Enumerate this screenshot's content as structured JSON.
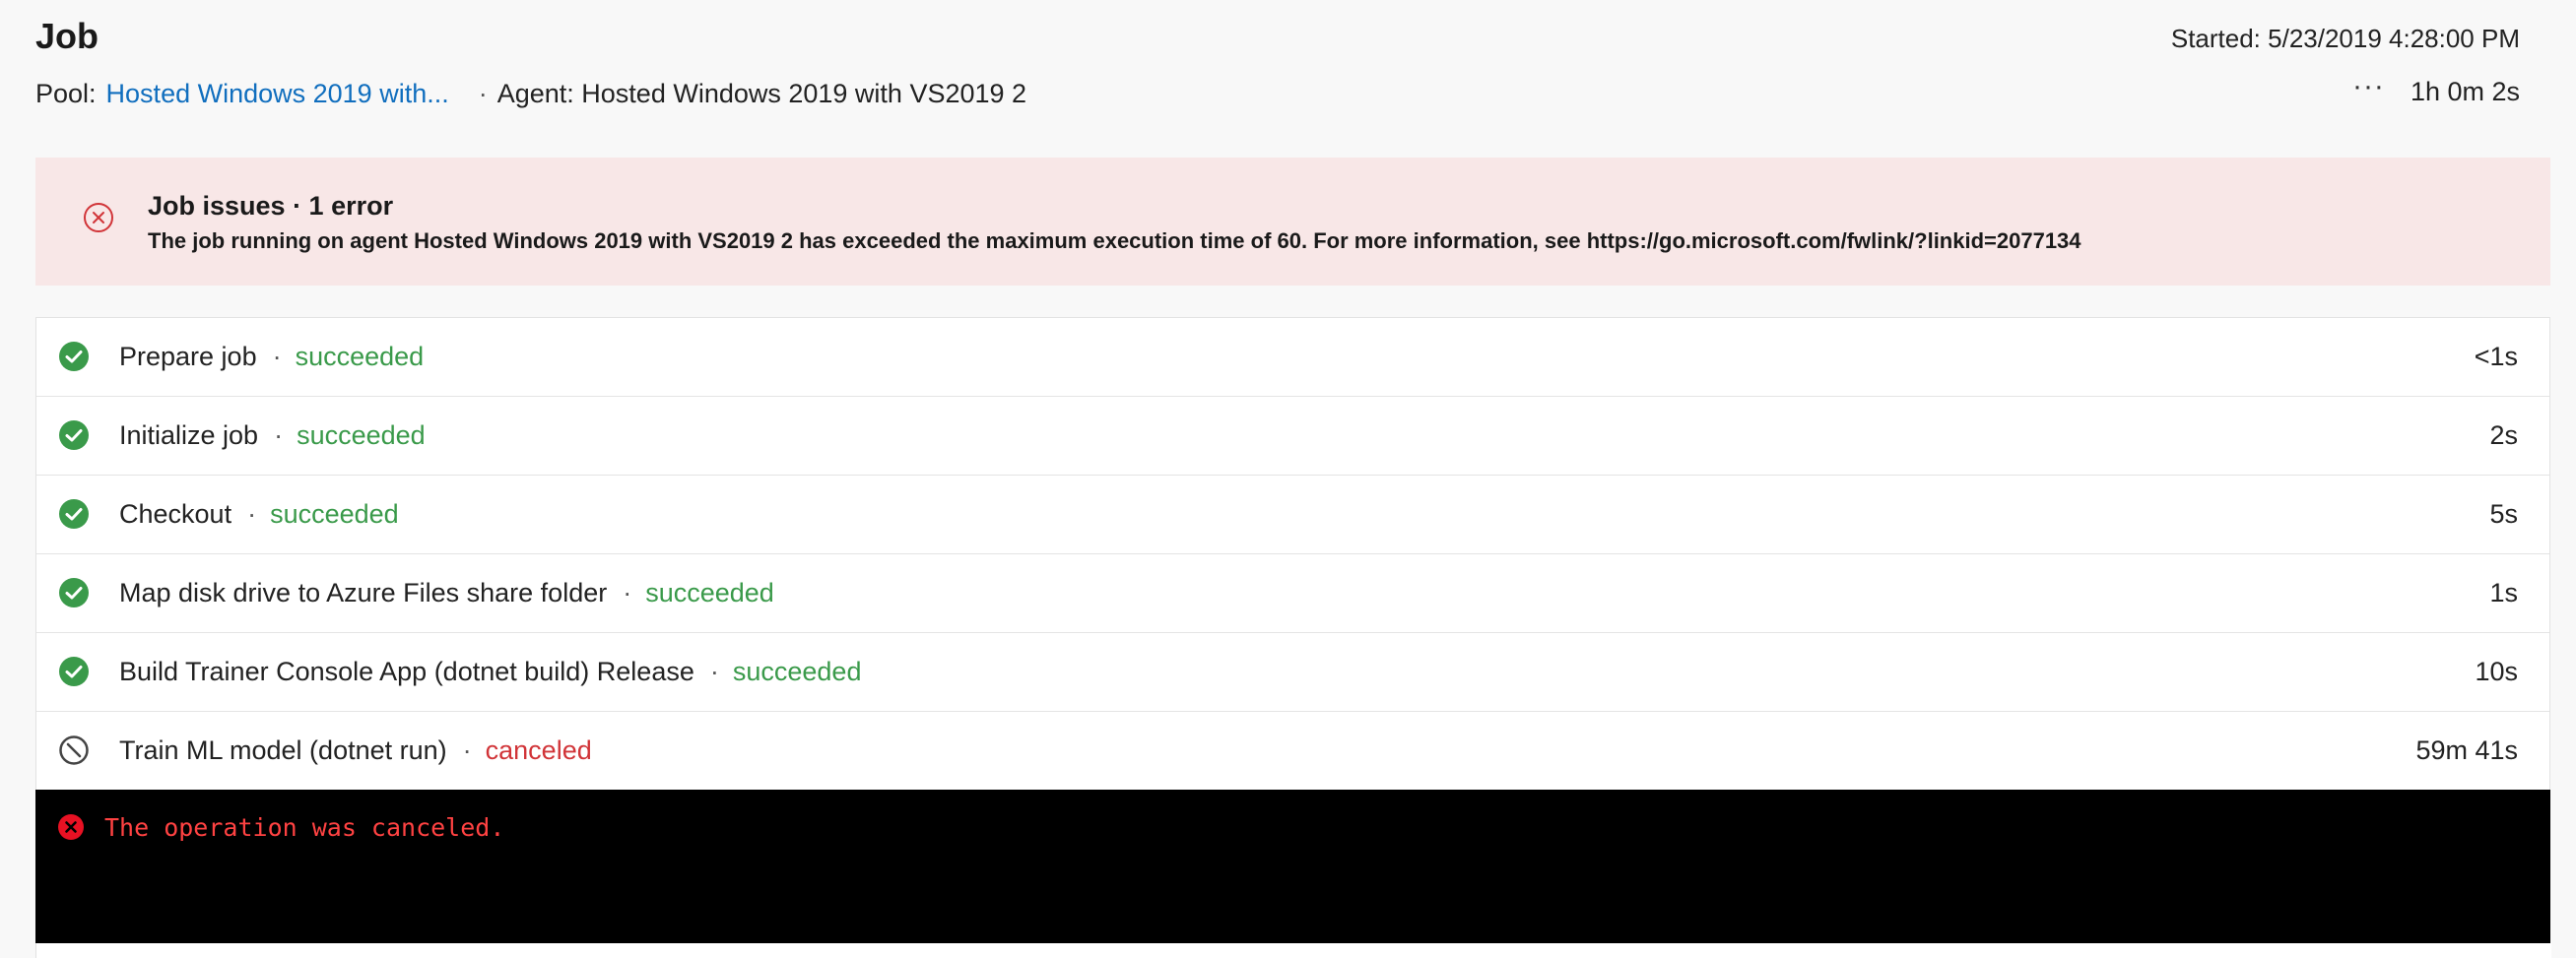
{
  "header": {
    "title": "Job",
    "started": "Started: 5/23/2019 4:28:00 PM",
    "pool_label": "Pool:",
    "pool_value": "Hosted Windows 2019 with...",
    "agent_sep": "·",
    "agent_text": "Agent: Hosted Windows 2019 with VS2019 2",
    "more_icon": "···",
    "duration": "1h 0m 2s"
  },
  "issues": {
    "title": "Job issues · 1 error",
    "message": "The job running on agent Hosted Windows 2019 with VS2019 2 has exceeded the maximum execution time of 60. For more information, see https://go.microsoft.com/fwlink/?linkid=2077134",
    "icon": "error-circle-icon",
    "color": "#d13438"
  },
  "steps": [
    {
      "name": "Prepare job",
      "dot": "·",
      "status": "succeeded",
      "time": "<1s"
    },
    {
      "name": "Initialize job",
      "dot": "·",
      "status": "succeeded",
      "time": "2s"
    },
    {
      "name": "Checkout",
      "dot": "·",
      "status": "succeeded",
      "time": "5s"
    },
    {
      "name": "Map disk drive to Azure Files share folder",
      "dot": "·",
      "status": "succeeded",
      "time": "1s"
    },
    {
      "name": "Build Trainer Console App (dotnet build) Release",
      "dot": "·",
      "status": "succeeded",
      "time": "10s"
    },
    {
      "name": "Train ML model (dotnet run)",
      "dot": "·",
      "status": "canceled",
      "time": "59m 41s"
    }
  ],
  "console": {
    "message": "The operation was canceled."
  },
  "colors": {
    "success": "#3a9a4a",
    "error": "#d13438",
    "link": "#106ebe",
    "banner": "#f8e7e7"
  }
}
